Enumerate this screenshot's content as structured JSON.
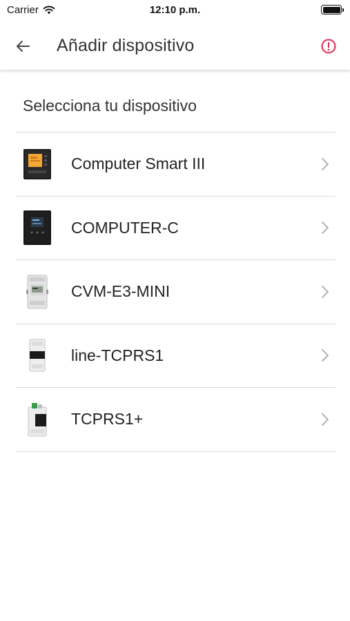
{
  "status_bar": {
    "carrier": "Carrier",
    "time": "12:10 p.m.",
    "icons": [
      "wifi-icon",
      "battery-icon"
    ]
  },
  "nav": {
    "title": "Añadir dispositivo",
    "back_icon": "arrow-left-icon",
    "info_icon": "info-icon",
    "accent_color": "#e2284f"
  },
  "section": {
    "title": "Selecciona tu dispositivo"
  },
  "devices": [
    {
      "name": "Computer Smart III",
      "icon": "computer-smart-iii-thumbnail"
    },
    {
      "name": "COMPUTER-C",
      "icon": "computer-c-thumbnail"
    },
    {
      "name": "CVM-E3-MINI",
      "icon": "cvm-e3-mini-thumbnail"
    },
    {
      "name": "line-TCPRS1",
      "icon": "line-tcprs1-thumbnail"
    },
    {
      "name": "TCPRS1+",
      "icon": "tcprs1-plus-thumbnail"
    }
  ]
}
